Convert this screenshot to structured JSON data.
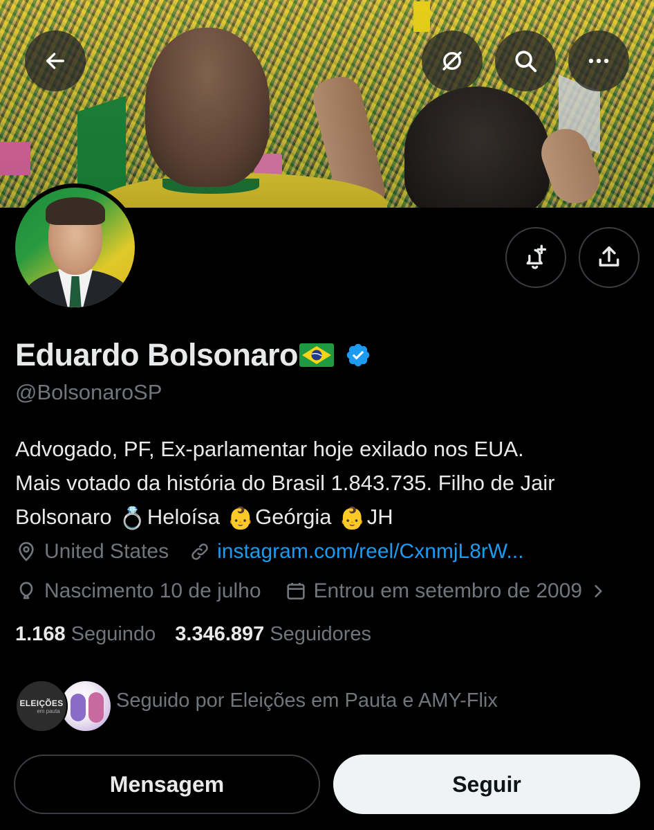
{
  "header": {
    "back_icon": "arrow-left-icon",
    "grok_icon": "grok-icon",
    "search_icon": "search-icon",
    "more_icon": "more-horizontal-icon"
  },
  "profile": {
    "name": "Eduardo Bolsonaro",
    "flag_emoji": "🇧🇷",
    "verified": true,
    "handle": "@BolsonaroSP",
    "bio_lines": [
      "Advogado, PF, Ex-parlamentar hoje exilado nos EUA.",
      "Mais votado da história do Brasil 1.843.735. Filho de Jair"
    ],
    "bio_line3": {
      "p1": "Bolsonaro ",
      "ring": "💍",
      "p2": "Heloísa ",
      "baby1": "👶",
      "p3": "Geórgia ",
      "baby2": "👶",
      "p4": "JH"
    },
    "location": "United States",
    "link": "instagram.com/reel/CxnmjL8rW...",
    "birthday": "Nascimento 10 de julho",
    "joined": "Entrou em setembro de 2009"
  },
  "stats": {
    "following_count": "1.168",
    "following_label": "Seguindo",
    "followers_count": "3.346.897",
    "followers_label": "Seguidores"
  },
  "followed_by": {
    "avatar1_text": "ELEIÇÕES",
    "avatar1_sub": "em pauta",
    "text": "Seguido por Eleições em Pauta e AMY-Flix"
  },
  "actions": {
    "message_label": "Mensagem",
    "follow_label": "Seguir",
    "notify_icon": "bell-plus-icon",
    "share_icon": "share-icon"
  },
  "colors": {
    "background": "#000000",
    "text_primary": "#e7e9ea",
    "text_secondary": "#71767b",
    "link": "#1d9bf0",
    "verified_badge": "#1d9bf0",
    "follow_button_bg": "#eff3f4"
  }
}
